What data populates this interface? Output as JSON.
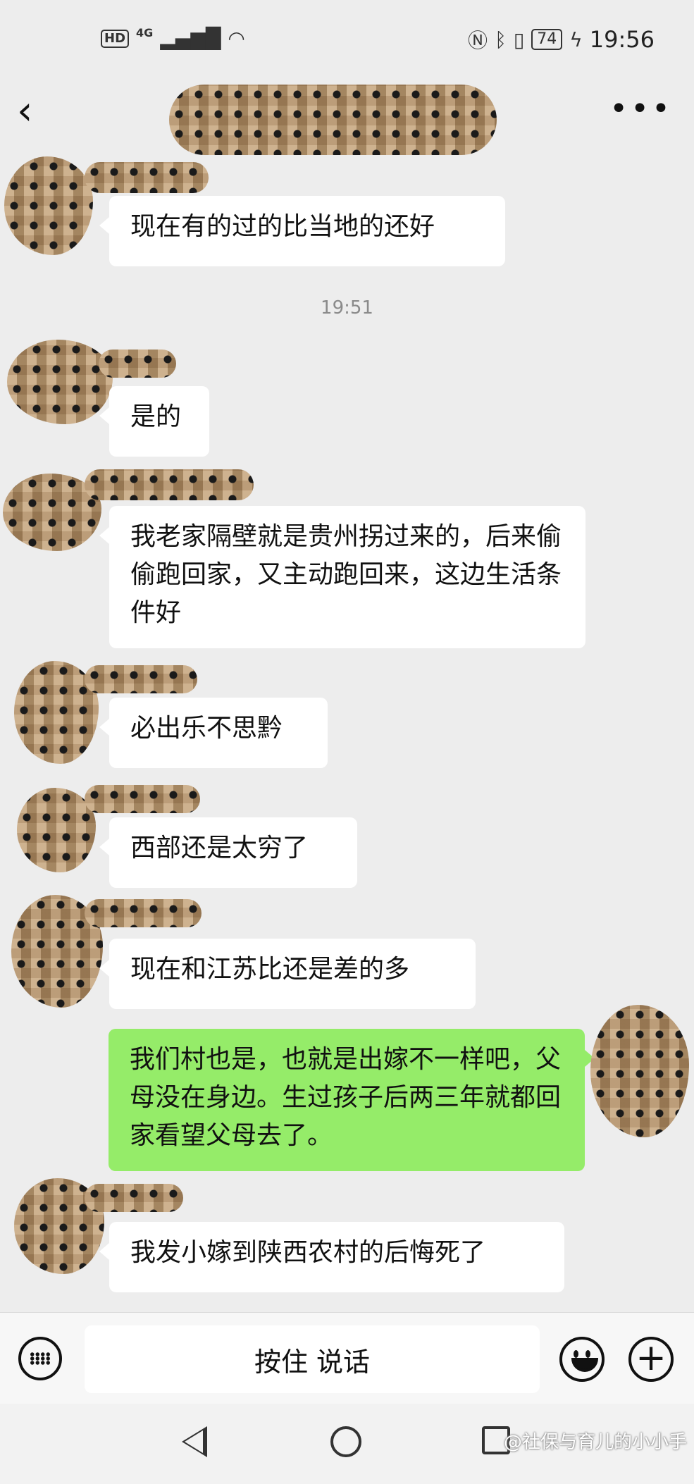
{
  "status_bar": {
    "hd": "HD",
    "network": "4G",
    "battery": "74",
    "time": "19:56"
  },
  "title_bar": {
    "back_icon": "chevron-left-icon",
    "more_icon": "more-dots-icon"
  },
  "messages": [
    {
      "side": "left",
      "text": "现在有的过的比当地的还好"
    },
    {
      "side": "timestamp",
      "text": "19:51"
    },
    {
      "side": "left",
      "text": "是的"
    },
    {
      "side": "left",
      "text": "我老家隔壁就是贵州拐过来的，后来偷偷跑回家，又主动跑回来，这边生活条件好"
    },
    {
      "side": "left",
      "text": "必出乐不思黔"
    },
    {
      "side": "left",
      "text": "西部还是太穷了"
    },
    {
      "side": "left",
      "text": "现在和江苏比还是差的多"
    },
    {
      "side": "right",
      "text": "我们村也是，也就是出嫁不一样吧，父母没在身边。生过孩子后两三年就都回家看望父母去了。"
    },
    {
      "side": "left",
      "text": "我发小嫁到陕西农村的后悔死了"
    }
  ],
  "input_bar": {
    "hold_to_talk": "按住 说话",
    "keyboard_icon": "keyboard-icon",
    "emoji_icon": "emoji-icon",
    "plus_icon": "plus-icon"
  },
  "watermark": "@社保与育儿的小小手"
}
